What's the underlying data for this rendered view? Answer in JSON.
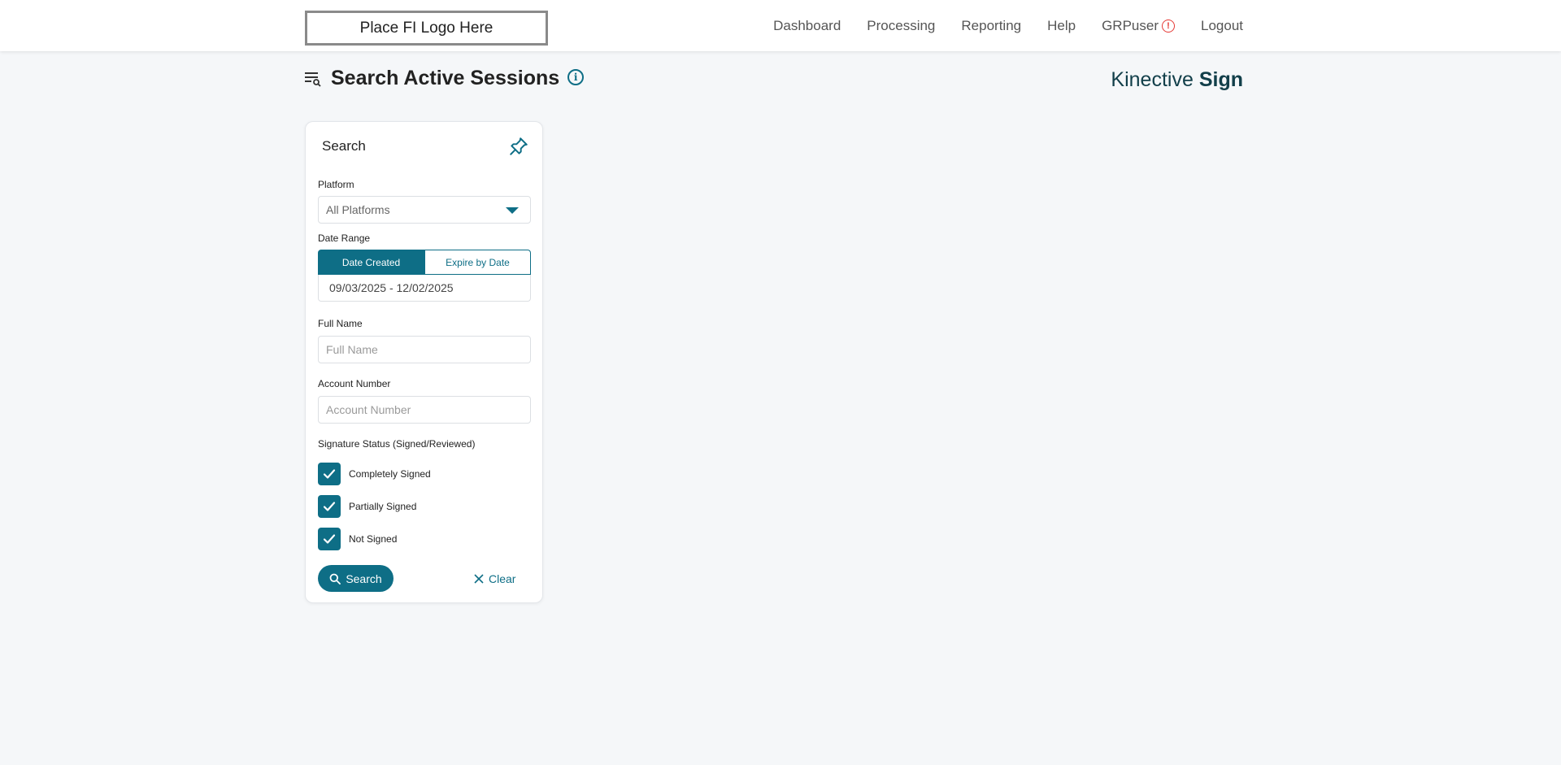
{
  "header": {
    "logo_text": "Place FI Logo Here",
    "nav": [
      {
        "label": "Dashboard"
      },
      {
        "label": "Processing"
      },
      {
        "label": "Reporting"
      },
      {
        "label": "Help"
      },
      {
        "label": "GRPuser"
      },
      {
        "label": "Logout"
      }
    ],
    "alert_icon": "alert-icon"
  },
  "page": {
    "title": "Search Active Sessions",
    "brand_light": "Kinective",
    "brand_bold": "Sign"
  },
  "search_panel": {
    "title": "Search",
    "platform_label": "Platform",
    "platform_value": "All Platforms",
    "date_range_label": "Date Range",
    "date_tabs": [
      "Date Created",
      "Expire by Date"
    ],
    "date_tab_selected": "Date Created",
    "date_range_value": "09/03/2025 - 12/02/2025",
    "full_name_label": "Full Name",
    "full_name_placeholder": "Full Name",
    "account_number_label": "Account Number",
    "account_number_placeholder": "Account Number",
    "signature_status_label": "Signature Status (Signed/Reviewed)",
    "statuses": [
      {
        "label": "Completely Signed",
        "checked": true
      },
      {
        "label": "Partially Signed",
        "checked": true
      },
      {
        "label": "Not Signed",
        "checked": true
      }
    ],
    "search_button": "Search",
    "clear_button": "Clear"
  },
  "colors": {
    "accent": "#0e6e86",
    "alert": "#e53935",
    "brand": "#123f4a"
  }
}
